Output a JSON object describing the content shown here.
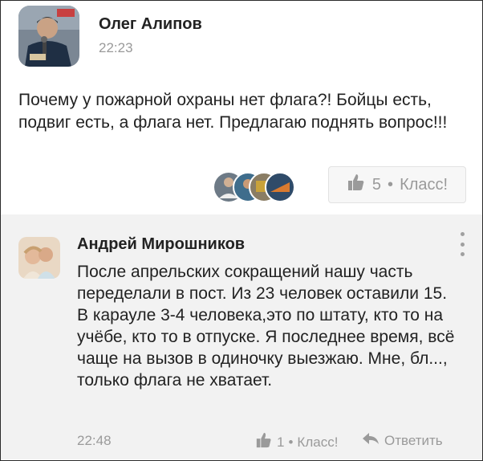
{
  "post": {
    "author": "Олег Алипов",
    "time": "22:23",
    "text": "Почему у пожарной охраны нет флага?! Бойцы есть, подвиг есть, а флага нет. Предлагаю поднять вопрос!!!",
    "likes": {
      "count": "5",
      "separator": "•",
      "label": "Класс!"
    }
  },
  "comment": {
    "author": "Андрей Мирошников",
    "text": "После апрельских сокращений нашу часть переделали в пост. Из 23 человек оставили 15. В карауле 3-4 человека,это по штату, кто то на учёбе, кто то в отпуске. Я последнее время, всё чаще на вызов в одиночку выезжаю. Мне, бл..., только флага не хватает.",
    "time": "22:48",
    "likes": {
      "count": "1",
      "separator": "•",
      "label": "Класс!"
    },
    "reply_label": "Ответить"
  },
  "icons": {
    "like": "thumbs-up-icon",
    "reply": "reply-arrow-icon",
    "menu": "more-vertical-icon"
  },
  "colors": {
    "text": "#222222",
    "muted": "#9a9a9a",
    "comment_bg": "#f2f2f2",
    "like_button_bg": "#f7f7f7"
  }
}
